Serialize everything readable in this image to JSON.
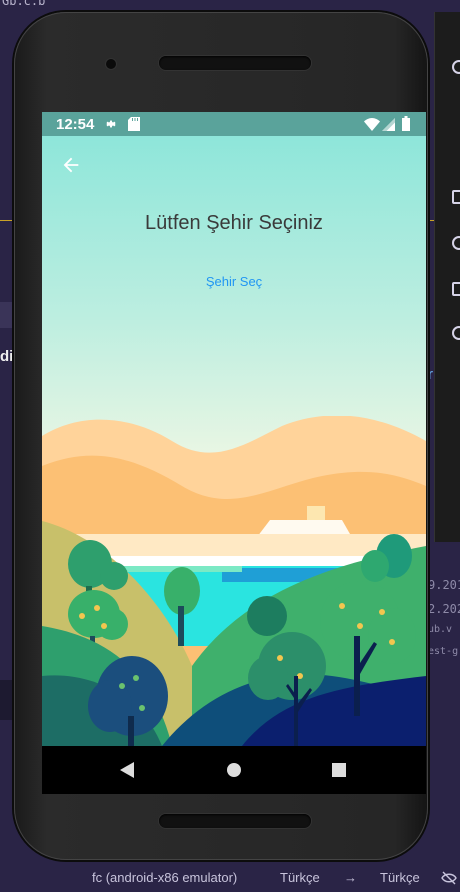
{
  "ide": {
    "corner_text": "Gb.c.b",
    "side_texts": [
      "9.201",
      "2.202",
      "ub.v",
      "est-g"
    ],
    "left_char": "di",
    "right_char": "r"
  },
  "device": {
    "status_bar": {
      "time": "12:54",
      "icons": [
        "settings-icon",
        "sd-card-icon",
        "wifi-icon",
        "signal-icon",
        "battery-icon"
      ]
    },
    "app": {
      "back_icon": "back-arrow-icon",
      "title": "Lütfen Şehir Seçiniz",
      "select_button": "Şehir Seç"
    },
    "nav_bar": {
      "buttons": [
        "back-triangle-icon",
        "home-circle-icon",
        "recents-square-icon"
      ]
    }
  },
  "taskbar": {
    "target": "fc (android-x86 emulator)",
    "language_from": "Türkçe",
    "arrow": "→",
    "language_to": "Türkçe"
  },
  "colors": {
    "status_bar": "#5aa39b",
    "accent": "#2196f3",
    "ide_bg": "#2a2446"
  }
}
